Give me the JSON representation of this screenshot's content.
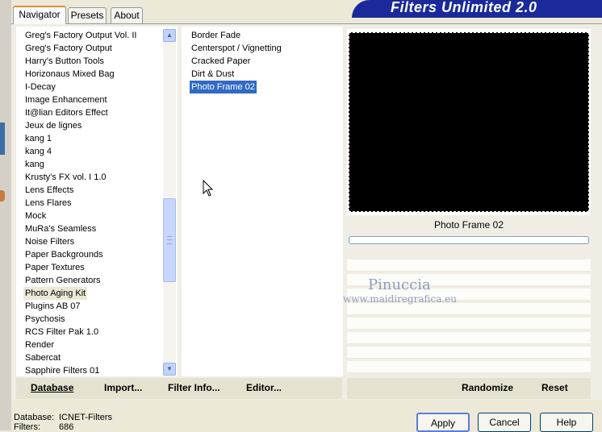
{
  "app_title": "Filters Unlimited 2.0",
  "tabs": [
    {
      "label": "Navigator"
    },
    {
      "label": "Presets"
    },
    {
      "label": "About"
    }
  ],
  "categories": [
    {
      "label": "Greg's Factory Output Vol. II"
    },
    {
      "label": "Greg's Factory Output"
    },
    {
      "label": "Harry's Button Tools"
    },
    {
      "label": "Horizonaus Mixed Bag"
    },
    {
      "label": "I-Decay"
    },
    {
      "label": "Image Enhancement"
    },
    {
      "label": "It@lian Editors Effect"
    },
    {
      "label": "Jeux de lignes"
    },
    {
      "label": "kang 1"
    },
    {
      "label": "kang 4"
    },
    {
      "label": "kang"
    },
    {
      "label": "Krusty's FX vol. I 1.0"
    },
    {
      "label": "Lens Effects"
    },
    {
      "label": "Lens Flares"
    },
    {
      "label": "Mock"
    },
    {
      "label": "MuRa's Seamless"
    },
    {
      "label": "Noise Filters"
    },
    {
      "label": "Paper Backgrounds"
    },
    {
      "label": "Paper Textures"
    },
    {
      "label": "Pattern Generators"
    },
    {
      "label": "Photo Aging Kit"
    },
    {
      "label": "Plugins AB 07"
    },
    {
      "label": "Psychosis"
    },
    {
      "label": "RCS Filter Pak 1.0"
    },
    {
      "label": "Render"
    },
    {
      "label": "Sabercat"
    },
    {
      "label": "Sapphire Filters 01"
    }
  ],
  "selected_category": "Photo Aging Kit",
  "filters": [
    {
      "label": "Border Fade"
    },
    {
      "label": "Centerspot / Vignetting"
    },
    {
      "label": "Cracked Paper"
    },
    {
      "label": "Dirt & Dust"
    },
    {
      "label": "Photo Frame 02"
    }
  ],
  "selected_filter": "Photo Frame 02",
  "preview": {
    "filter_name": "Photo Frame 02"
  },
  "watermark": {
    "line1": "Pinuccia",
    "line2": "www.maidiregrafica.eu"
  },
  "bottom_buttons": {
    "database": "Database",
    "import": "Import...",
    "filter_info": "Filter Info...",
    "editor": "Editor...",
    "randomize": "Randomize",
    "reset": "Reset"
  },
  "status": {
    "database_label": "Database:",
    "database_value": "ICNET-Filters",
    "filters_label": "Filters:",
    "filters_value": "686"
  },
  "dialog_buttons": {
    "apply": "Apply",
    "cancel": "Cancel",
    "help": "Help"
  },
  "colors": {
    "banner": "#1a2a9a",
    "selection": "#316ac5",
    "tab_highlight": "#e68b2c"
  }
}
